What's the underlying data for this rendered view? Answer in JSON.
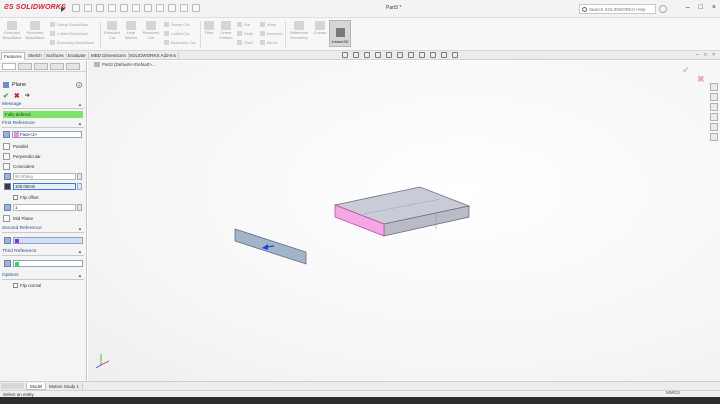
{
  "app": {
    "logo_text": "SOLIDWORKS",
    "document_title": "Part3 *",
    "search_placeholder": "Search SOLIDWORKS Help",
    "window_buttons": [
      "–",
      "□",
      "×"
    ]
  },
  "ribbon": {
    "items": [
      {
        "label": "Extruded\nBoss/Base"
      },
      {
        "label": "Revolved\nBoss/Base"
      },
      {
        "label": "Extruded\nCut"
      },
      {
        "label": "Hole\nWizard"
      },
      {
        "label": "Revolved\nCut"
      },
      {
        "label": "Fillet"
      },
      {
        "label": "Linear\nPattern"
      },
      {
        "label": "Reference\nGeometry"
      },
      {
        "label": "Curves"
      }
    ],
    "small_items": [
      "Swept Boss/Base",
      "Lofted Boss/Base",
      "Boundary Boss/Base",
      "Swept Cut",
      "Lofted Cut",
      "Boundary Cut",
      "Rib",
      "Draft",
      "Shell",
      "Wrap",
      "Intersect",
      "Mirror"
    ],
    "instant3d_label": "Instant3D"
  },
  "tabs": [
    {
      "label": "Features",
      "active": true
    },
    {
      "label": "Sketch",
      "active": false
    },
    {
      "label": "Surfaces",
      "active": false
    },
    {
      "label": "Evaluate",
      "active": false
    },
    {
      "label": "MBD Dimensions",
      "active": false
    },
    {
      "label": "SOLIDWORKS Add-Ins",
      "active": false
    }
  ],
  "property_manager": {
    "title": "Plane",
    "help": "?",
    "message_header": "Message",
    "message": "Fully defined",
    "first_reference": {
      "header": "First Reference",
      "value": "Face<1>",
      "color": "#f08fd0",
      "options": [
        "Parallel",
        "Perpendicular",
        "Coincident"
      ],
      "angle_value": "90.00deg",
      "distance_value": "100.00mm",
      "flip_offset": "Flip offset",
      "instances_value": "1",
      "mid_plane": "Mid Plane"
    },
    "second_reference": {
      "header": "Second Reference",
      "color": "#7a3ad8"
    },
    "third_reference": {
      "header": "Third Reference",
      "color": "#3ad85a"
    },
    "options": {
      "header": "Options",
      "flip_normal": "Flip normal"
    }
  },
  "graphics": {
    "tree_label": "Part3  (Default<<Default>...",
    "check_ok": "✔",
    "check_cancel": "✖"
  },
  "bottom_tabs": [
    {
      "label": "Model",
      "active": true
    },
    {
      "label": "Motion Study 1",
      "active": false
    }
  ],
  "status": {
    "text": "Select an entity",
    "units": "MMGS"
  }
}
